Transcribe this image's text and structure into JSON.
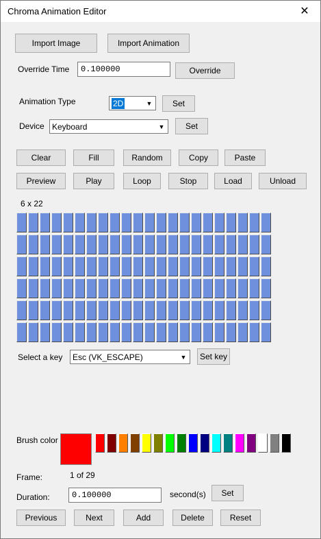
{
  "window": {
    "title": "Chroma Animation Editor",
    "close_glyph": "✕"
  },
  "import": {
    "image_label": "Import Image",
    "animation_label": "Import Animation"
  },
  "override": {
    "label": "Override Time",
    "value": "0.100000",
    "button": "Override"
  },
  "animation_type": {
    "label": "Animation Type",
    "value": "2D",
    "set_label": "Set"
  },
  "device": {
    "label": "Device",
    "value": "Keyboard",
    "set_label": "Set"
  },
  "edit_buttons": [
    "Clear",
    "Fill",
    "Random",
    "Copy",
    "Paste"
  ],
  "playback_buttons": [
    "Preview",
    "Play",
    "Loop",
    "Stop",
    "Load",
    "Unload"
  ],
  "grid": {
    "label": "6 x 22",
    "rows": 6,
    "cols": 22,
    "cell_color": "#6f90dd"
  },
  "key": {
    "label": "Select a key",
    "value": "Esc (VK_ESCAPE)",
    "button": "Set key"
  },
  "brush": {
    "label": "Brush color",
    "current_color": "#ff0000",
    "palette": [
      "#ff0000",
      "#800000",
      "#ff8000",
      "#804000",
      "#ffff00",
      "#808000",
      "#00ff00",
      "#008000",
      "#0000ff",
      "#000080",
      "#00ffff",
      "#008080",
      "#ff00ff",
      "#800080",
      "#ffffff",
      "#808080",
      "#000000"
    ]
  },
  "frame": {
    "label": "Frame:",
    "value": "1 of 29"
  },
  "duration": {
    "label": "Duration:",
    "value": "0.100000",
    "unit": "second(s)",
    "set_label": "Set"
  },
  "nav_buttons": [
    "Previous",
    "Next",
    "Add",
    "Delete",
    "Reset"
  ]
}
